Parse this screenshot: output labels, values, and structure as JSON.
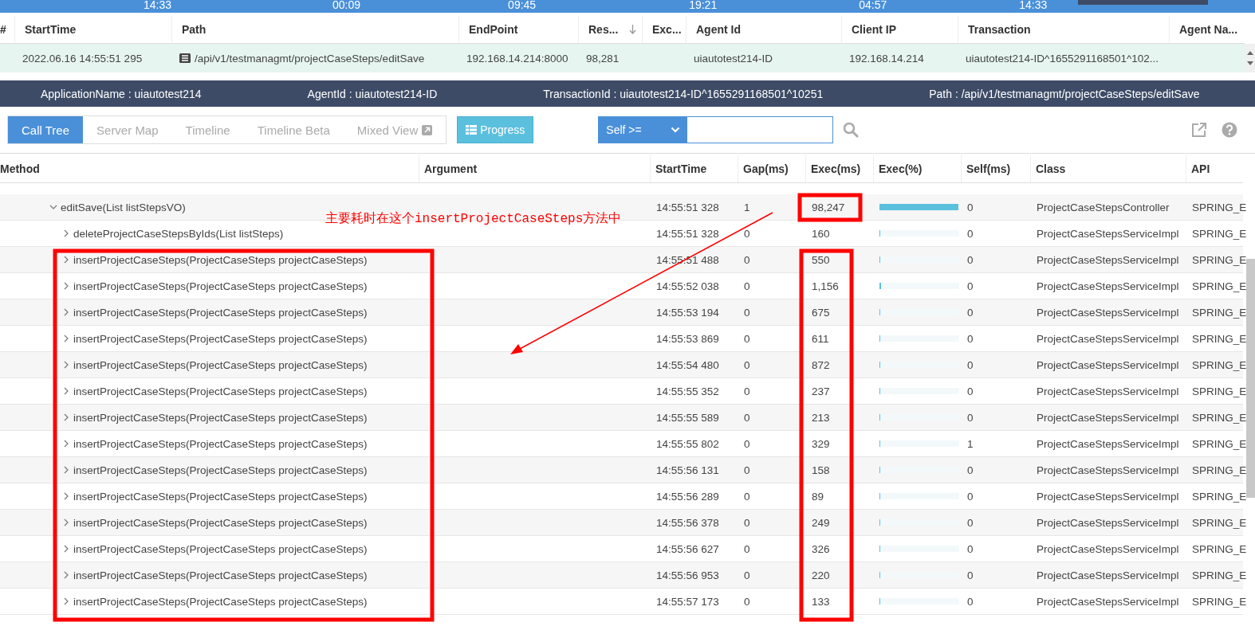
{
  "timeline": {
    "ticks": [
      "14:33",
      "00:09",
      "09:45",
      "19:21",
      "04:57",
      "14:33"
    ]
  },
  "transactions": {
    "columns": [
      {
        "label": "#",
        "sorted": false
      },
      {
        "label": "StartTime",
        "sorted": false
      },
      {
        "label": "Path",
        "sorted": false
      },
      {
        "label": "EndPoint",
        "sorted": false
      },
      {
        "label": "Res...",
        "sorted": true
      },
      {
        "label": "Exc...",
        "sorted": false
      },
      {
        "label": "Agent Id",
        "sorted": false
      },
      {
        "label": "Client IP",
        "sorted": false
      },
      {
        "label": "Transaction",
        "sorted": false
      },
      {
        "label": "Agent Na...",
        "sorted": false
      }
    ],
    "rows": [
      {
        "selected": true,
        "cells": [
          "",
          "2022.06.16 14:55:51 295",
          "/api/v1/testmanagmt/projectCaseSteps/editSave",
          "192.168.14.214:8000",
          "98,281",
          "",
          "uiautotest214-ID",
          "192.168.14.214",
          "uiautotest214-ID^1655291168501^102...",
          ""
        ]
      }
    ]
  },
  "info_bar": [
    {
      "label": "ApplicationName : uiautotest214"
    },
    {
      "label": "AgentId : uiautotest214-ID"
    },
    {
      "label": "TransactionId : uiautotest214-ID^1655291168501^10251"
    },
    {
      "label": "Path : /api/v1/testmanagmt/projectCaseSteps/editSave"
    }
  ],
  "tabs": [
    {
      "label": "Call Tree",
      "selected": true
    },
    {
      "label": "Server Map",
      "selected": false
    },
    {
      "label": "Timeline",
      "selected": false
    },
    {
      "label": "Timeline Beta",
      "selected": false
    },
    {
      "label": "Mixed View",
      "selected": false,
      "external": true
    }
  ],
  "progress_button": "Progress",
  "filter": {
    "select": "Self >="
  },
  "call_tree": {
    "columns": [
      "Method",
      "Argument",
      "StartTime",
      "Gap(ms)",
      "Exec(ms)",
      "Exec(%)",
      "Self(ms)",
      "Class",
      "API"
    ],
    "rows": [
      {
        "method": "editSave(List listStepsVO)",
        "expanded": true,
        "start": "14:55:51 328",
        "gap": "1",
        "exec": "98,247",
        "level": 0.99,
        "self": "0",
        "class": "ProjectCaseStepsController",
        "api": "SPRING_E",
        "children": [
          {
            "method": "deleteProjectCaseStepsByIds(List listSteps)",
            "expanded": false,
            "start": "14:55:51 328",
            "gap": "0",
            "exec": "160",
            "level": 0.01,
            "self": "0",
            "class": "ProjectCaseStepsServiceImpl",
            "api": "SPRING_E"
          },
          {
            "method": "insertProjectCaseSteps(ProjectCaseSteps projectCaseSteps)",
            "expanded": false,
            "start": "14:55:51 488",
            "gap": "0",
            "exec": "550",
            "level": 0.01,
            "self": "0",
            "class": "ProjectCaseStepsServiceImpl",
            "api": "SPRING_E"
          },
          {
            "method": "insertProjectCaseSteps(ProjectCaseSteps projectCaseSteps)",
            "expanded": false,
            "start": "14:55:52 038",
            "gap": "0",
            "exec": "1,156",
            "level": 0.015,
            "self": "0",
            "class": "ProjectCaseStepsServiceImpl",
            "api": "SPRING_E"
          },
          {
            "method": "insertProjectCaseSteps(ProjectCaseSteps projectCaseSteps)",
            "expanded": false,
            "start": "14:55:53 194",
            "gap": "0",
            "exec": "675",
            "level": 0.01,
            "self": "0",
            "class": "ProjectCaseStepsServiceImpl",
            "api": "SPRING_E"
          },
          {
            "method": "insertProjectCaseSteps(ProjectCaseSteps projectCaseSteps)",
            "expanded": false,
            "start": "14:55:53 869",
            "gap": "0",
            "exec": "611",
            "level": 0.01,
            "self": "0",
            "class": "ProjectCaseStepsServiceImpl",
            "api": "SPRING_E"
          },
          {
            "method": "insertProjectCaseSteps(ProjectCaseSteps projectCaseSteps)",
            "expanded": false,
            "start": "14:55:54 480",
            "gap": "0",
            "exec": "872",
            "level": 0.01,
            "self": "0",
            "class": "ProjectCaseStepsServiceImpl",
            "api": "SPRING_E"
          },
          {
            "method": "insertProjectCaseSteps(ProjectCaseSteps projectCaseSteps)",
            "expanded": false,
            "start": "14:55:55 352",
            "gap": "0",
            "exec": "237",
            "level": 0.01,
            "self": "0",
            "class": "ProjectCaseStepsServiceImpl",
            "api": "SPRING_E"
          },
          {
            "method": "insertProjectCaseSteps(ProjectCaseSteps projectCaseSteps)",
            "expanded": false,
            "start": "14:55:55 589",
            "gap": "0",
            "exec": "213",
            "level": 0.01,
            "self": "0",
            "class": "ProjectCaseStepsServiceImpl",
            "api": "SPRING_E"
          },
          {
            "method": "insertProjectCaseSteps(ProjectCaseSteps projectCaseSteps)",
            "expanded": false,
            "start": "14:55:55 802",
            "gap": "0",
            "exec": "329",
            "level": 0.01,
            "self": "1",
            "class": "ProjectCaseStepsServiceImpl",
            "api": "SPRING_E"
          },
          {
            "method": "insertProjectCaseSteps(ProjectCaseSteps projectCaseSteps)",
            "expanded": false,
            "start": "14:55:56 131",
            "gap": "0",
            "exec": "158",
            "level": 0.01,
            "self": "0",
            "class": "ProjectCaseStepsServiceImpl",
            "api": "SPRING_E"
          },
          {
            "method": "insertProjectCaseSteps(ProjectCaseSteps projectCaseSteps)",
            "expanded": false,
            "start": "14:55:56 289",
            "gap": "0",
            "exec": "89",
            "level": 0.01,
            "self": "0",
            "class": "ProjectCaseStepsServiceImpl",
            "api": "SPRING_E"
          },
          {
            "method": "insertProjectCaseSteps(ProjectCaseSteps projectCaseSteps)",
            "expanded": false,
            "start": "14:55:56 378",
            "gap": "0",
            "exec": "249",
            "level": 0.01,
            "self": "0",
            "class": "ProjectCaseStepsServiceImpl",
            "api": "SPRING_E"
          },
          {
            "method": "insertProjectCaseSteps(ProjectCaseSteps projectCaseSteps)",
            "expanded": false,
            "start": "14:55:56 627",
            "gap": "0",
            "exec": "326",
            "level": 0.01,
            "self": "0",
            "class": "ProjectCaseStepsServiceImpl",
            "api": "SPRING_E"
          },
          {
            "method": "insertProjectCaseSteps(ProjectCaseSteps projectCaseSteps)",
            "expanded": false,
            "start": "14:55:56 953",
            "gap": "0",
            "exec": "220",
            "level": 0.01,
            "self": "0",
            "class": "ProjectCaseStepsServiceImpl",
            "api": "SPRING_E"
          },
          {
            "method": "insertProjectCaseSteps(ProjectCaseSteps projectCaseSteps)",
            "expanded": false,
            "start": "14:55:57 173",
            "gap": "0",
            "exec": "133",
            "level": 0.01,
            "self": "0",
            "class": "ProjectCaseStepsServiceImpl",
            "api": "SPRING_E"
          }
        ]
      }
    ]
  },
  "annotation": {
    "text": "主要耗时在这个insertProjectCaseSteps方法中"
  }
}
